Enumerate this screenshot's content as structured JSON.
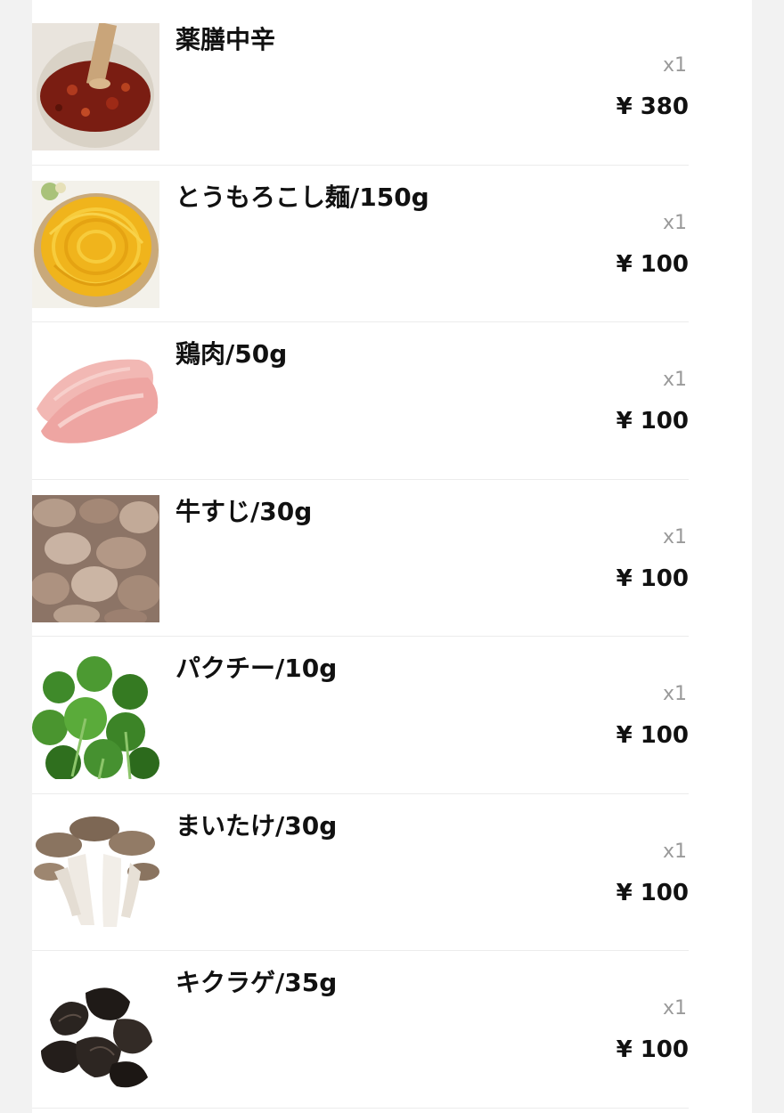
{
  "items": [
    {
      "name": "薬膳中辛",
      "qty": "x1",
      "price": "¥ 380",
      "icon": "spicy-paste-image"
    },
    {
      "name": "とうもろこし麺/150g",
      "qty": "x1",
      "price": "¥ 100",
      "icon": "corn-noodles-image"
    },
    {
      "name": "鶏肉/50g",
      "qty": "x1",
      "price": "¥ 100",
      "icon": "chicken-image"
    },
    {
      "name": "牛すじ/30g",
      "qty": "x1",
      "price": "¥ 100",
      "icon": "beef-tendon-image"
    },
    {
      "name": "パクチー/10g",
      "qty": "x1",
      "price": "¥ 100",
      "icon": "cilantro-image"
    },
    {
      "name": "まいたけ/30g",
      "qty": "x1",
      "price": "¥ 100",
      "icon": "maitake-image"
    },
    {
      "name": "キクラゲ/35g",
      "qty": "x1",
      "price": "¥ 100",
      "icon": "wood-ear-image"
    }
  ]
}
